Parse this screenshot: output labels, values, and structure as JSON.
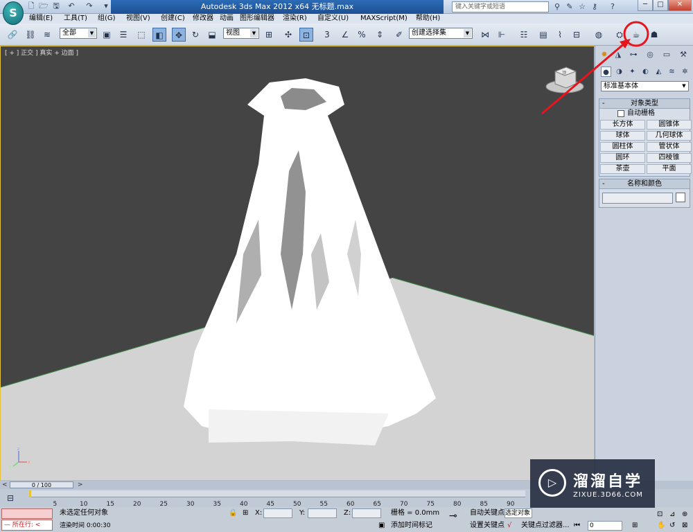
{
  "app": {
    "logo_text": "S",
    "title": "Autodesk 3ds Max  2012 x64   无标题.max",
    "search_placeholder": "键入关键字或短语",
    "window_buttons": [
      "─",
      "□",
      "✕"
    ]
  },
  "menus": [
    "编辑(E)",
    "工具(T)",
    "组(G)",
    "视图(V)",
    "创建(C)",
    "修改器",
    "动画",
    "图形编辑器",
    "渲染(R)",
    "自定义(U)",
    "MAXScript(M)",
    "帮助(H)"
  ],
  "toolbar": {
    "selection_filter": "全部",
    "reference_coord": "视图",
    "snap_3": "3",
    "named_selection": "创建选择集"
  },
  "viewport": {
    "label": "[ + ] 正交 ] 真实 + 边面 ]",
    "cube_label": "顶"
  },
  "command_panel": {
    "category": "标准基本体",
    "object_type": {
      "title": "对象类型",
      "autogrid": "自动栅格",
      "buttons": [
        "长方体",
        "圆锥体",
        "球体",
        "几何球体",
        "圆柱体",
        "管状体",
        "圆环",
        "四棱锥",
        "茶壶",
        "平面"
      ]
    },
    "name_color": {
      "title": "名称和颜色"
    }
  },
  "timeline": {
    "slider": "0 / 100",
    "ticks": [
      "0",
      "5",
      "10",
      "15",
      "20",
      "25",
      "30",
      "35",
      "40",
      "45",
      "50",
      "55",
      "60",
      "65",
      "70",
      "75",
      "80",
      "85",
      "90"
    ]
  },
  "status": {
    "maxscript_label": "所在行:",
    "selection": "未选定任何对象",
    "render_time": "渲染时间  0:00:30",
    "x_label": "X:",
    "y_label": "Y:",
    "z_label": "Z:",
    "grid": "栅格 = 0.0mm",
    "add_time_tag": "添加时间标记",
    "auto_key": "自动关键点",
    "auto_key_value": "选定对象",
    "set_key": "设置关键点",
    "key_filters": "关键点过滤器...",
    "frame": "0"
  },
  "watermark": {
    "cn": "溜溜自学",
    "en": "ZIXUE.3D66.COM"
  },
  "colors": {
    "viewport_bg": "#444444",
    "ground": "#d3d3d3",
    "annotation": "#e8141c",
    "title_bar": "#1d4f92"
  }
}
